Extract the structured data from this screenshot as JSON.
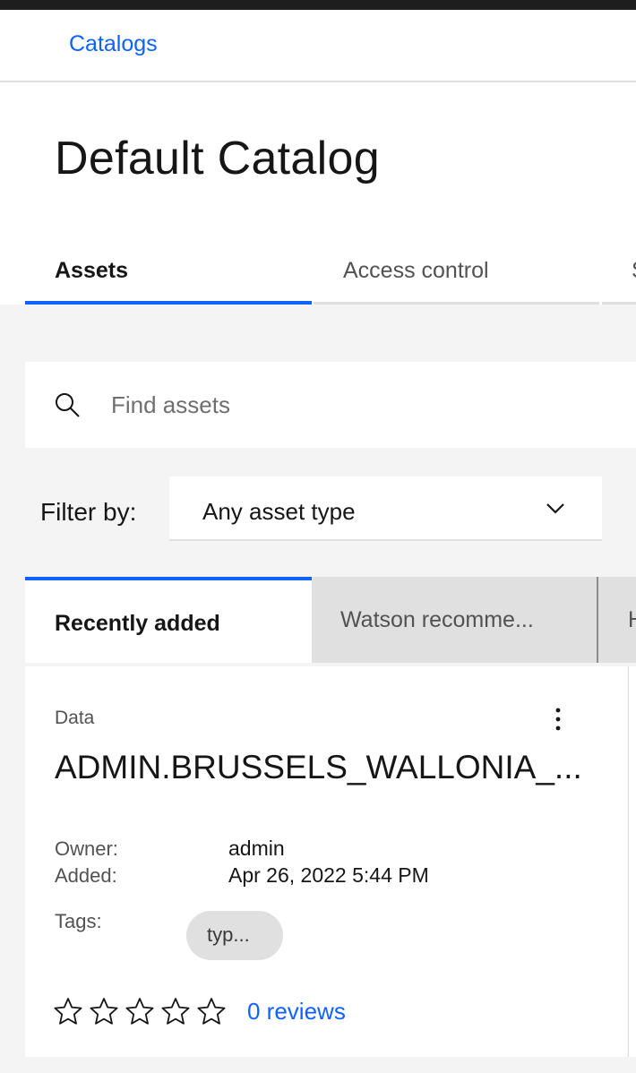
{
  "header": {
    "breadcrumb": "Catalogs"
  },
  "page": {
    "title": "Default Catalog"
  },
  "tabs": [
    {
      "label": "Assets",
      "active": true
    },
    {
      "label": "Access control",
      "active": false
    },
    {
      "label": "S",
      "active": false
    }
  ],
  "search": {
    "placeholder": "Find assets",
    "icon": "search-icon"
  },
  "filter": {
    "label": "Filter by:",
    "selected": "Any asset type",
    "icon": "chevron-down-icon"
  },
  "subtabs": [
    {
      "label": "Recently added",
      "active": true
    },
    {
      "label": "Watson recomme...",
      "active": false
    },
    {
      "label": "H",
      "active": false
    }
  ],
  "card": {
    "type": "Data",
    "name": "ADMIN.BRUSSELS_WALLONIA_...",
    "owner_label": "Owner:",
    "owner": "admin",
    "added_label": "Added:",
    "added": "Apr 26, 2022 5:44 PM",
    "tags_label": "Tags:",
    "tags": [
      "typ..."
    ],
    "rating": 0,
    "max_rating": 5,
    "reviews": "0 reviews"
  },
  "colors": {
    "accent": "#0f62fe",
    "background": "#f4f4f4",
    "surface": "#ffffff",
    "tag_bg": "#e0e0e0"
  }
}
